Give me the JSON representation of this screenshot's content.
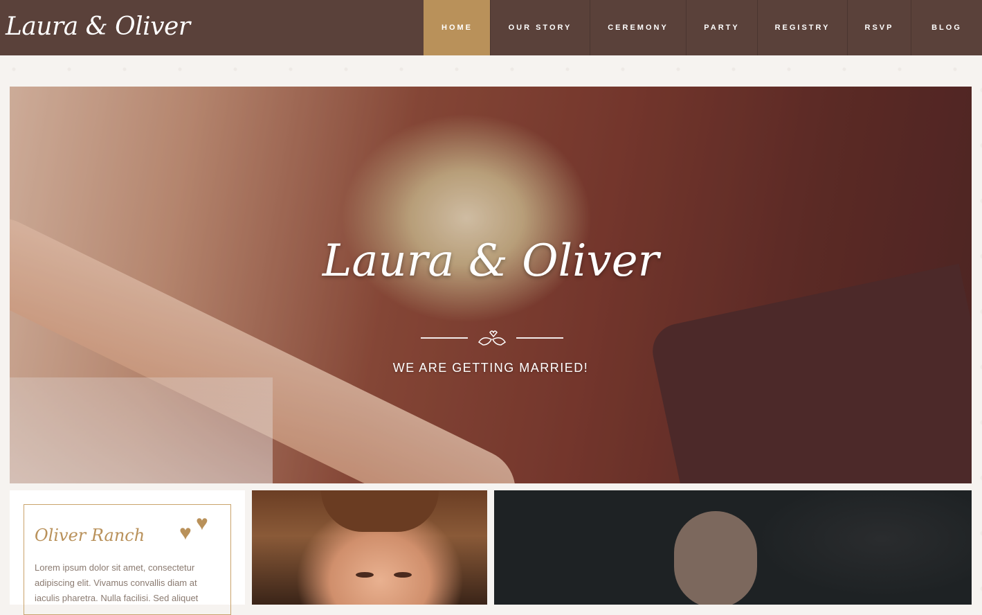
{
  "brand": {
    "logo": "Laura & Oliver"
  },
  "nav": {
    "items": [
      {
        "label": "HOME",
        "active": true
      },
      {
        "label": "OUR STORY",
        "active": false
      },
      {
        "label": "CEREMONY",
        "active": false
      },
      {
        "label": "PARTY",
        "active": false
      },
      {
        "label": "REGISTRY",
        "active": false
      },
      {
        "label": "RSVP",
        "active": false
      },
      {
        "label": "BLOG",
        "active": false
      }
    ]
  },
  "hero": {
    "title": "Laura & Oliver",
    "subtitle": "WE ARE GETTING MARRIED!",
    "divider_icon": "love-birds-icon"
  },
  "profile": {
    "name": "Oliver Ranch",
    "text": "Lorem ipsum dolor sit amet, consectetur adipiscing elit. Vivamus convallis diam at iaculis pharetra. Nulla facilisi. Sed aliquet",
    "icon": "hearts-icon"
  },
  "colors": {
    "nav_bg": "#5a413a",
    "accent": "#b9915a",
    "page_bg": "#f6f3f0"
  }
}
